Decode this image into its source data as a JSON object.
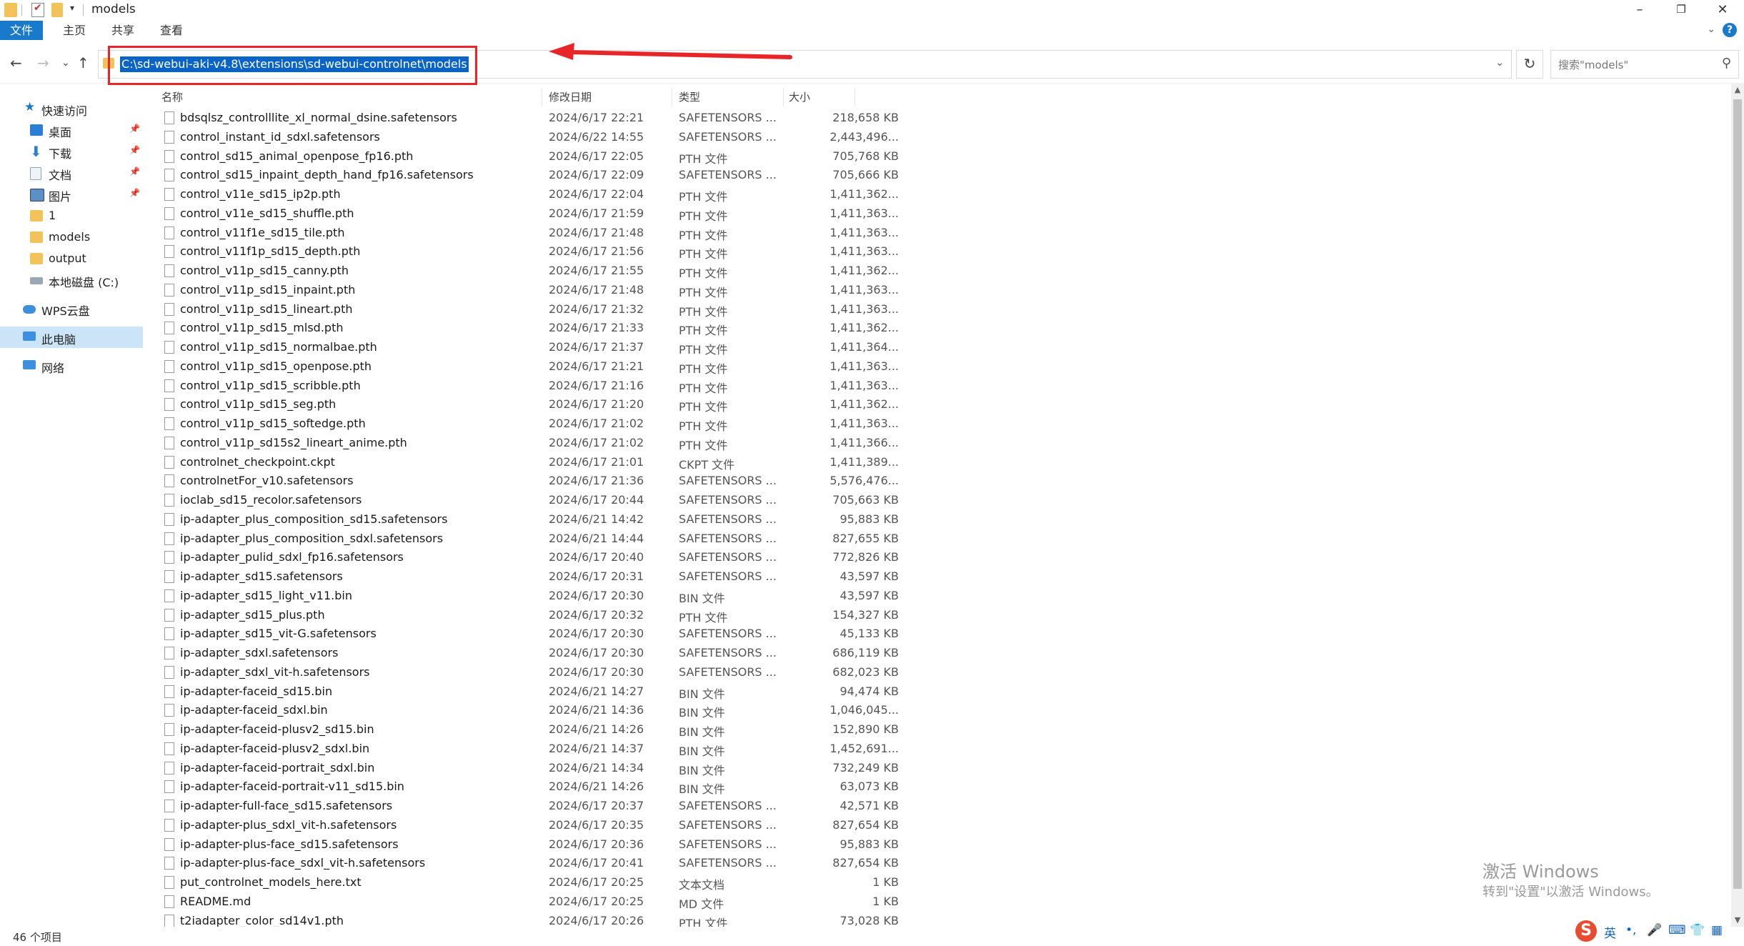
{
  "window": {
    "title": "models",
    "min": "–",
    "max": "❐",
    "close": "✕"
  },
  "ribbon": {
    "tabs": [
      "文件",
      "主页",
      "共享",
      "查看"
    ],
    "help": "?"
  },
  "nav": {
    "back": "←",
    "forward": "→",
    "recent": "⌄",
    "up": "↑",
    "refresh": "↻",
    "dropdown": "⌄"
  },
  "address": {
    "path": "C:\\sd-webui-aki-v4.8\\extensions\\sd-webui-controlnet\\models"
  },
  "search": {
    "placeholder": "搜索\"models\""
  },
  "sidebar": {
    "items": [
      {
        "label": "快速访问",
        "icon": "star-icon"
      },
      {
        "label": "桌面",
        "icon": "desktop-icon"
      },
      {
        "label": "下载",
        "icon": "download-icon"
      },
      {
        "label": "文档",
        "icon": "document-icon"
      },
      {
        "label": "图片",
        "icon": "picture-icon"
      },
      {
        "label": "1",
        "icon": "folder-icon"
      },
      {
        "label": "models",
        "icon": "folder-icon"
      },
      {
        "label": "output",
        "icon": "folder-icon"
      },
      {
        "label": "本地磁盘 (C:)",
        "icon": "drive-icon"
      },
      {
        "label": "WPS云盘",
        "icon": "cloud-icon"
      },
      {
        "label": "此电脑",
        "icon": "computer-icon"
      },
      {
        "label": "网络",
        "icon": "network-icon"
      }
    ]
  },
  "columns": {
    "name": "名称",
    "date": "修改日期",
    "type": "类型",
    "size": "大小"
  },
  "files": [
    {
      "name": "bdsqlsz_controlllite_xl_normal_dsine.safetensors",
      "date": "2024/6/17 22:21",
      "type": "SAFETENSORS ...",
      "size": "218,658 KB"
    },
    {
      "name": "control_instant_id_sdxl.safetensors",
      "date": "2024/6/22 14:55",
      "type": "SAFETENSORS ...",
      "size": "2,443,496..."
    },
    {
      "name": "control_sd15_animal_openpose_fp16.pth",
      "date": "2024/6/17 22:05",
      "type": "PTH 文件",
      "size": "705,768 KB"
    },
    {
      "name": "control_sd15_inpaint_depth_hand_fp16.safetensors",
      "date": "2024/6/17 22:09",
      "type": "SAFETENSORS ...",
      "size": "705,666 KB"
    },
    {
      "name": "control_v11e_sd15_ip2p.pth",
      "date": "2024/6/17 22:04",
      "type": "PTH 文件",
      "size": "1,411,362..."
    },
    {
      "name": "control_v11e_sd15_shuffle.pth",
      "date": "2024/6/17 21:59",
      "type": "PTH 文件",
      "size": "1,411,363..."
    },
    {
      "name": "control_v11f1e_sd15_tile.pth",
      "date": "2024/6/17 21:48",
      "type": "PTH 文件",
      "size": "1,411,363..."
    },
    {
      "name": "control_v11f1p_sd15_depth.pth",
      "date": "2024/6/17 21:56",
      "type": "PTH 文件",
      "size": "1,411,363..."
    },
    {
      "name": "control_v11p_sd15_canny.pth",
      "date": "2024/6/17 21:55",
      "type": "PTH 文件",
      "size": "1,411,362..."
    },
    {
      "name": "control_v11p_sd15_inpaint.pth",
      "date": "2024/6/17 21:48",
      "type": "PTH 文件",
      "size": "1,411,363..."
    },
    {
      "name": "control_v11p_sd15_lineart.pth",
      "date": "2024/6/17 21:32",
      "type": "PTH 文件",
      "size": "1,411,363..."
    },
    {
      "name": "control_v11p_sd15_mlsd.pth",
      "date": "2024/6/17 21:33",
      "type": "PTH 文件",
      "size": "1,411,362..."
    },
    {
      "name": "control_v11p_sd15_normalbae.pth",
      "date": "2024/6/17 21:37",
      "type": "PTH 文件",
      "size": "1,411,364..."
    },
    {
      "name": "control_v11p_sd15_openpose.pth",
      "date": "2024/6/17 21:21",
      "type": "PTH 文件",
      "size": "1,411,363..."
    },
    {
      "name": "control_v11p_sd15_scribble.pth",
      "date": "2024/6/17 21:16",
      "type": "PTH 文件",
      "size": "1,411,363..."
    },
    {
      "name": "control_v11p_sd15_seg.pth",
      "date": "2024/6/17 21:20",
      "type": "PTH 文件",
      "size": "1,411,362..."
    },
    {
      "name": "control_v11p_sd15_softedge.pth",
      "date": "2024/6/17 21:02",
      "type": "PTH 文件",
      "size": "1,411,363..."
    },
    {
      "name": "control_v11p_sd15s2_lineart_anime.pth",
      "date": "2024/6/17 21:02",
      "type": "PTH 文件",
      "size": "1,411,366..."
    },
    {
      "name": "controlnet_checkpoint.ckpt",
      "date": "2024/6/17 21:01",
      "type": "CKPT 文件",
      "size": "1,411,389..."
    },
    {
      "name": "controlnetFor_v10.safetensors",
      "date": "2024/6/17 21:36",
      "type": "SAFETENSORS ...",
      "size": "5,576,476..."
    },
    {
      "name": "ioclab_sd15_recolor.safetensors",
      "date": "2024/6/17 20:44",
      "type": "SAFETENSORS ...",
      "size": "705,663 KB"
    },
    {
      "name": "ip-adapter_plus_composition_sd15.safetensors",
      "date": "2024/6/21 14:42",
      "type": "SAFETENSORS ...",
      "size": "95,883 KB"
    },
    {
      "name": "ip-adapter_plus_composition_sdxl.safetensors",
      "date": "2024/6/21 14:44",
      "type": "SAFETENSORS ...",
      "size": "827,655 KB"
    },
    {
      "name": "ip-adapter_pulid_sdxl_fp16.safetensors",
      "date": "2024/6/17 20:40",
      "type": "SAFETENSORS ...",
      "size": "772,826 KB"
    },
    {
      "name": "ip-adapter_sd15.safetensors",
      "date": "2024/6/17 20:31",
      "type": "SAFETENSORS ...",
      "size": "43,597 KB"
    },
    {
      "name": "ip-adapter_sd15_light_v11.bin",
      "date": "2024/6/17 20:30",
      "type": "BIN 文件",
      "size": "43,597 KB"
    },
    {
      "name": "ip-adapter_sd15_plus.pth",
      "date": "2024/6/17 20:32",
      "type": "PTH 文件",
      "size": "154,327 KB"
    },
    {
      "name": "ip-adapter_sd15_vit-G.safetensors",
      "date": "2024/6/17 20:30",
      "type": "SAFETENSORS ...",
      "size": "45,133 KB"
    },
    {
      "name": "ip-adapter_sdxl.safetensors",
      "date": "2024/6/17 20:30",
      "type": "SAFETENSORS ...",
      "size": "686,119 KB"
    },
    {
      "name": "ip-adapter_sdxl_vit-h.safetensors",
      "date": "2024/6/17 20:30",
      "type": "SAFETENSORS ...",
      "size": "682,023 KB"
    },
    {
      "name": "ip-adapter-faceid_sd15.bin",
      "date": "2024/6/21 14:27",
      "type": "BIN 文件",
      "size": "94,474 KB"
    },
    {
      "name": "ip-adapter-faceid_sdxl.bin",
      "date": "2024/6/21 14:36",
      "type": "BIN 文件",
      "size": "1,046,045..."
    },
    {
      "name": "ip-adapter-faceid-plusv2_sd15.bin",
      "date": "2024/6/21 14:26",
      "type": "BIN 文件",
      "size": "152,890 KB"
    },
    {
      "name": "ip-adapter-faceid-plusv2_sdxl.bin",
      "date": "2024/6/21 14:37",
      "type": "BIN 文件",
      "size": "1,452,691..."
    },
    {
      "name": "ip-adapter-faceid-portrait_sdxl.bin",
      "date": "2024/6/21 14:34",
      "type": "BIN 文件",
      "size": "732,249 KB"
    },
    {
      "name": "ip-adapter-faceid-portrait-v11_sd15.bin",
      "date": "2024/6/21 14:26",
      "type": "BIN 文件",
      "size": "63,073 KB"
    },
    {
      "name": "ip-adapter-full-face_sd15.safetensors",
      "date": "2024/6/17 20:37",
      "type": "SAFETENSORS ...",
      "size": "42,571 KB"
    },
    {
      "name": "ip-adapter-plus_sdxl_vit-h.safetensors",
      "date": "2024/6/17 20:35",
      "type": "SAFETENSORS ...",
      "size": "827,654 KB"
    },
    {
      "name": "ip-adapter-plus-face_sd15.safetensors",
      "date": "2024/6/17 20:36",
      "type": "SAFETENSORS ...",
      "size": "95,883 KB"
    },
    {
      "name": "ip-adapter-plus-face_sdxl_vit-h.safetensors",
      "date": "2024/6/17 20:41",
      "type": "SAFETENSORS ...",
      "size": "827,654 KB"
    },
    {
      "name": "put_controlnet_models_here.txt",
      "date": "2024/6/17 20:25",
      "type": "文本文档",
      "size": "1 KB"
    },
    {
      "name": "README.md",
      "date": "2024/6/17 20:25",
      "type": "MD 文件",
      "size": "1 KB"
    },
    {
      "name": "t2iadapter_color_sd14v1.pth",
      "date": "2024/6/17 20:26",
      "type": "PTH 文件",
      "size": "73,028 KB"
    }
  ],
  "status": {
    "item_count": "46 个项目"
  },
  "watermark": {
    "line1": "激活 Windows",
    "line2": "转到\"设置\"以激活 Windows。"
  },
  "tray": {
    "ime_logo": "S",
    "lang": "英",
    "punct": "•,",
    "mic": "🎤",
    "keyboard": "⌨",
    "shirt": "👕",
    "grid": "▦"
  },
  "colors": {
    "accent": "#1979ca",
    "selection": "#0a64c8",
    "annotation": "#e8262a",
    "nav_selected": "#cce4f7"
  }
}
